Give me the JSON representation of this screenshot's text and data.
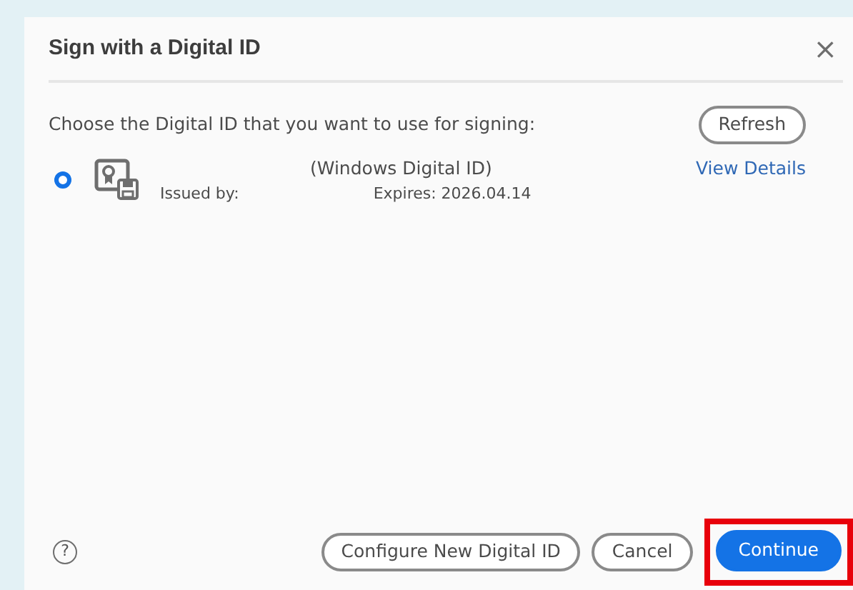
{
  "dialog": {
    "title": "Sign with a Digital ID",
    "close": "×"
  },
  "instruction": "Choose the Digital ID that you want to use for signing:",
  "refresh_button": "Refresh",
  "digital_ids": [
    {
      "selected": true,
      "type": "(Windows Digital ID)",
      "issued_by": "Issued by:",
      "expires": "Expires: 2026.04.14",
      "details_link": "View Details"
    }
  ],
  "help": "?",
  "buttons": [
    {
      "label": "Configure New Digital ID",
      "kind": "secondary",
      "highlighted": false
    },
    {
      "label": "Cancel",
      "kind": "secondary",
      "highlighted": false
    },
    {
      "label": "Continue",
      "kind": "primary",
      "highlighted": true
    }
  ]
}
